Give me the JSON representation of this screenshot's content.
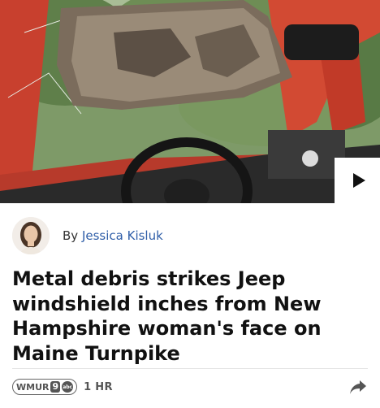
{
  "article": {
    "byline_prefix": "By",
    "author_name": "Jessica Kisluk",
    "headline": "Metal debris strikes Jeep windshield inches from New Hampshire woman's face on Maine Turnpike",
    "time_ago": "1 HR"
  },
  "station": {
    "logo_text": "WMUR",
    "logo_number": "9",
    "logo_network": "abc"
  },
  "icons": {
    "play": "play-icon",
    "share": "share-icon"
  },
  "colors": {
    "author_link": "#2f5ea8",
    "headline": "#111111",
    "meta": "#555555"
  }
}
